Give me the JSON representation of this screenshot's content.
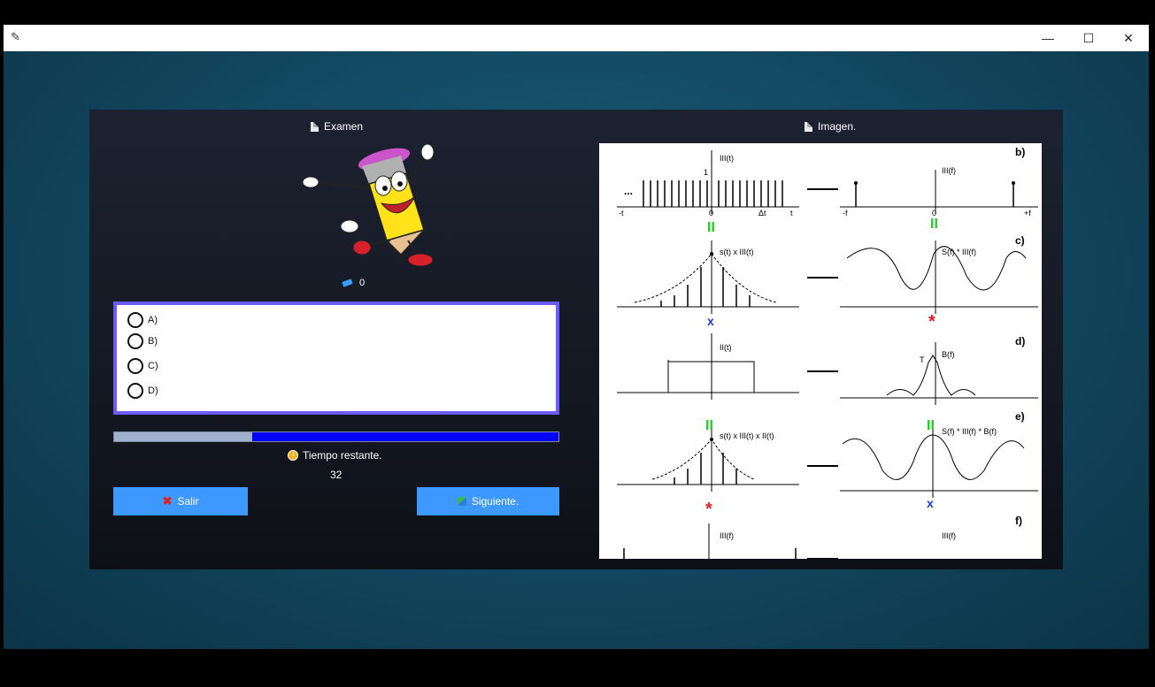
{
  "window": {
    "app_icon": "pencil-app-icon",
    "controls": {
      "minimize": "—",
      "maximize": "☐",
      "close": "✕"
    }
  },
  "exam": {
    "header": "Examen",
    "score": "0",
    "options": [
      "A)",
      "B)",
      "C)",
      "D)"
    ],
    "progress": 0.31,
    "timer_label": "Tiempo restante.",
    "timer_value": "32",
    "exit_label": "Salir",
    "next_label": "Siguiente."
  },
  "image_panel": {
    "header": "Imagen.",
    "row_labels": [
      "b)",
      "c)",
      "d)",
      "e)",
      "f)"
    ],
    "time_axis": {
      "neg": "-t",
      "pos": "t",
      "zero": "0",
      "delta": "Δt"
    },
    "freq_axis": {
      "neg": "-f",
      "pos": "+f",
      "zero": "0"
    },
    "labels": {
      "b_left": "III(t)",
      "b_right": "III(f)",
      "one": "1",
      "c_left": "s(t) x III(t)",
      "c_right": "S(f) * III(f)",
      "d_left": "II(t)",
      "d_right": "B(f)",
      "e_left": "s(t) x III(t) x II(t)",
      "e_right": "S(f) * III(f) * B(f)",
      "f_left": "III(f)",
      "f_right": "III(f)",
      "T": "T",
      "dots": "...",
      "equals": "II",
      "star": "*",
      "cross": "x"
    }
  },
  "colors": {
    "accent": "#3d99ff",
    "border": "#6c5cff",
    "progress": "#0000ff",
    "equals": "#22cc22",
    "star": "#e02020",
    "cross": "#1a3fcc"
  }
}
